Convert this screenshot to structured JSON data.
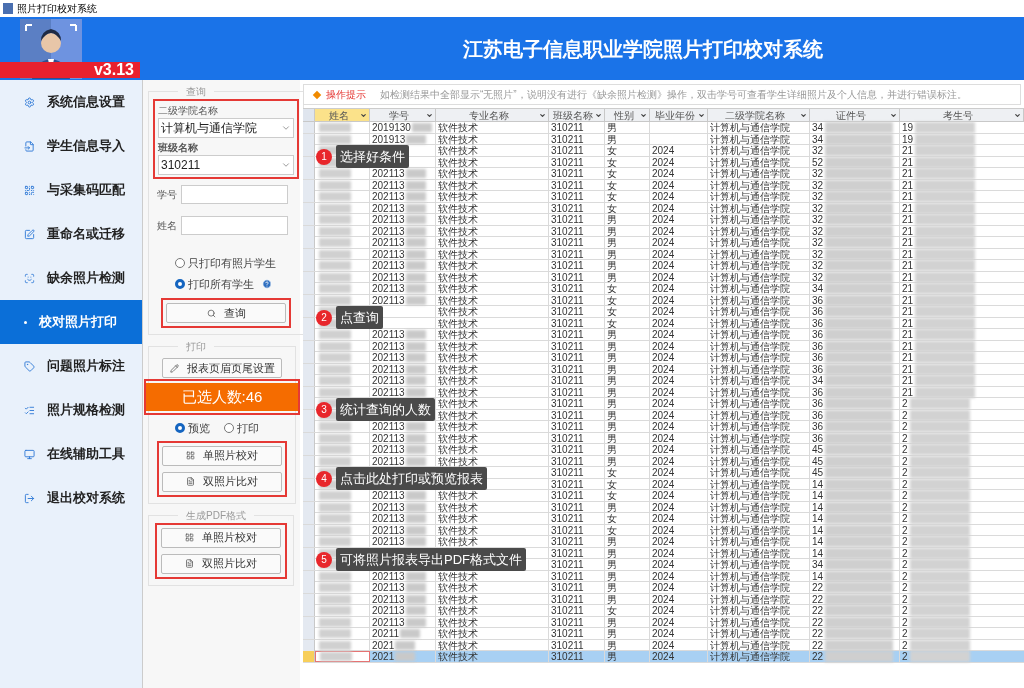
{
  "window": {
    "title": "照片打印校对系统"
  },
  "header": {
    "version": "v3.13",
    "title": "江苏电子信息职业学院照片打印校对系统"
  },
  "sidebar": {
    "items": [
      {
        "label": "系统信息设置",
        "selected": false
      },
      {
        "label": "学生信息导入",
        "selected": false
      },
      {
        "label": "与采集码匹配",
        "selected": false
      },
      {
        "label": "重命名或迁移",
        "selected": false
      },
      {
        "label": "缺余照片检测",
        "selected": false
      },
      {
        "label": "校对照片打印",
        "selected": true
      },
      {
        "label": "问题照片标注",
        "selected": false
      },
      {
        "label": "照片规格检测",
        "selected": false
      },
      {
        "label": "在线辅助工具",
        "selected": false
      },
      {
        "label": "退出校对系统",
        "selected": false
      }
    ]
  },
  "query_panel": {
    "title": "查询",
    "college_label": "二级学院名称",
    "college_value": "计算机与通信学院",
    "class_label": "班级名称",
    "class_value": "310211",
    "student_id_label": "学号",
    "name_label": "姓名",
    "options": [
      {
        "label": "只打印有照片学生",
        "selected": false
      },
      {
        "label": "打印所有学生",
        "selected": true
      }
    ],
    "button": "查询"
  },
  "print_panel": {
    "title": "打印",
    "setup_button": "报表页眉页尾设置",
    "count": "已选人数:46",
    "modes": [
      {
        "label": "预览",
        "selected": true
      },
      {
        "label": "打印",
        "selected": false
      }
    ],
    "buttons": [
      "单照片校对",
      "双照片比对"
    ]
  },
  "pdf_panel": {
    "title": "生成PDF格式",
    "buttons": [
      "单照片校对",
      "双照片比对"
    ]
  },
  "tip": {
    "label": "操作提示",
    "text": "如检测结果中全部显示“无照片”，说明没有进行《缺余照片检测》操作，双击学号可查看学生详细照片及个人信息，并进行错误标注。"
  },
  "table": {
    "columns": [
      {
        "label": "姓名",
        "selected": true
      },
      {
        "label": "学号",
        "selected": false
      },
      {
        "label": "专业名称",
        "selected": false
      },
      {
        "label": "班级名称",
        "selected": false
      },
      {
        "label": "性别",
        "selected": false
      },
      {
        "label": "毕业年份",
        "selected": false
      },
      {
        "label": "二级学院名称",
        "selected": false
      },
      {
        "label": "证件号",
        "selected": false
      },
      {
        "label": "考生号",
        "selected": false
      }
    ],
    "rows": [
      {
        "student_id": "2019130",
        "major": "软件技术",
        "class": "310211",
        "gender": "男",
        "college": "计算机与通信学院",
        "id_number": "34",
        "exam_number": "19",
        "selected": false
      },
      {
        "student_id": "201913",
        "major": "软件技术",
        "class": "310211",
        "gender": "男",
        "college": "计算机与通信学院",
        "id_number": "34",
        "exam_number": "19",
        "selected": false
      },
      {
        "major": "软件技术",
        "class": "310211",
        "gender": "女",
        "year": "2024",
        "college": "计算机与通信学院",
        "id_number": "32",
        "exam_number": "21",
        "selected": false
      },
      {
        "major": "软件技术",
        "class": "310211",
        "gender": "女",
        "year": "2024",
        "college": "计算机与通信学院",
        "id_number": "52",
        "exam_number": "21",
        "selected": false
      },
      {
        "student_id": "202113",
        "major": "软件技术",
        "class": "310211",
        "gender": "女",
        "year": "2024",
        "college": "计算机与通信学院",
        "id_number": "32",
        "exam_number": "21",
        "selected": false
      },
      {
        "student_id": "202113",
        "major": "软件技术",
        "class": "310211",
        "gender": "女",
        "year": "2024",
        "college": "计算机与通信学院",
        "id_number": "32",
        "exam_number": "21",
        "selected": false
      },
      {
        "student_id": "202113",
        "major": "软件技术",
        "class": "310211",
        "gender": "女",
        "year": "2024",
        "college": "计算机与通信学院",
        "id_number": "32",
        "exam_number": "21",
        "selected": false
      },
      {
        "student_id": "202113",
        "major": "软件技术",
        "class": "310211",
        "gender": "女",
        "year": "2024",
        "college": "计算机与通信学院",
        "id_number": "32",
        "exam_number": "21",
        "selected": false
      },
      {
        "student_id": "202113",
        "major": "软件技术",
        "class": "310211",
        "gender": "男",
        "year": "2024",
        "college": "计算机与通信学院",
        "id_number": "32",
        "exam_number": "21",
        "selected": false
      },
      {
        "student_id": "202113",
        "major": "软件技术",
        "class": "310211",
        "gender": "男",
        "year": "2024",
        "college": "计算机与通信学院",
        "id_number": "32",
        "exam_number": "21",
        "selected": false
      },
      {
        "student_id": "202113",
        "major": "软件技术",
        "class": "310211",
        "gender": "男",
        "year": "2024",
        "college": "计算机与通信学院",
        "id_number": "32",
        "exam_number": "21",
        "selected": false
      },
      {
        "student_id": "202113",
        "major": "软件技术",
        "class": "310211",
        "gender": "男",
        "year": "2024",
        "college": "计算机与通信学院",
        "id_number": "32",
        "exam_number": "21",
        "selected": false
      },
      {
        "student_id": "202113",
        "major": "软件技术",
        "class": "310211",
        "gender": "男",
        "year": "2024",
        "college": "计算机与通信学院",
        "id_number": "32",
        "exam_number": "21",
        "selected": false
      },
      {
        "student_id": "202113",
        "major": "软件技术",
        "class": "310211",
        "gender": "男",
        "year": "2024",
        "college": "计算机与通信学院",
        "id_number": "32",
        "exam_number": "21",
        "selected": false
      },
      {
        "student_id": "202113",
        "major": "软件技术",
        "class": "310211",
        "gender": "女",
        "year": "2024",
        "college": "计算机与通信学院",
        "id_number": "34",
        "exam_number": "21",
        "selected": false
      },
      {
        "student_id": "202113",
        "major": "软件技术",
        "class": "310211",
        "gender": "女",
        "year": "2024",
        "college": "计算机与通信学院",
        "id_number": "36",
        "exam_number": "21",
        "selected": false
      },
      {
        "major": "软件技术",
        "class": "310211",
        "gender": "女",
        "year": "2024",
        "college": "计算机与通信学院",
        "id_number": "36",
        "exam_number": "21",
        "selected": false
      },
      {
        "major": "软件技术",
        "class": "310211",
        "gender": "女",
        "year": "2024",
        "college": "计算机与通信学院",
        "id_number": "36",
        "exam_number": "21",
        "selected": false
      },
      {
        "student_id": "202113",
        "major": "软件技术",
        "class": "310211",
        "gender": "男",
        "year": "2024",
        "college": "计算机与通信学院",
        "id_number": "36",
        "exam_number": "21",
        "selected": false
      },
      {
        "student_id": "202113",
        "major": "软件技术",
        "class": "310211",
        "gender": "男",
        "year": "2024",
        "college": "计算机与通信学院",
        "id_number": "36",
        "exam_number": "21",
        "selected": false
      },
      {
        "student_id": "202113",
        "major": "软件技术",
        "class": "310211",
        "gender": "男",
        "year": "2024",
        "college": "计算机与通信学院",
        "id_number": "36",
        "exam_number": "21",
        "selected": false
      },
      {
        "student_id": "202113",
        "major": "软件技术",
        "class": "310211",
        "gender": "男",
        "year": "2024",
        "college": "计算机与通信学院",
        "id_number": "36",
        "exam_number": "21",
        "selected": false
      },
      {
        "student_id": "202113",
        "major": "软件技术",
        "class": "310211",
        "gender": "男",
        "year": "2024",
        "college": "计算机与通信学院",
        "id_number": "34",
        "exam_number": "21",
        "selected": false
      },
      {
        "student_id": "202113",
        "major": "软件技术",
        "class": "310211",
        "gender": "男",
        "year": "2024",
        "college": "计算机与通信学院",
        "id_number": "36",
        "exam_number": "21",
        "selected": false
      },
      {
        "major": "软件技术",
        "class": "310211",
        "gender": "男",
        "year": "2024",
        "college": "计算机与通信学院",
        "id_number": "36",
        "exam_number": "2",
        "selected": false
      },
      {
        "major": "软件技术",
        "class": "310211",
        "gender": "男",
        "year": "2024",
        "college": "计算机与通信学院",
        "id_number": "36",
        "exam_number": "2",
        "selected": false
      },
      {
        "student_id": "202113",
        "major": "软件技术",
        "class": "310211",
        "gender": "男",
        "year": "2024",
        "college": "计算机与通信学院",
        "id_number": "36",
        "exam_number": "2",
        "selected": false
      },
      {
        "student_id": "202113",
        "major": "软件技术",
        "class": "310211",
        "gender": "男",
        "year": "2024",
        "college": "计算机与通信学院",
        "id_number": "36",
        "exam_number": "2",
        "selected": false
      },
      {
        "student_id": "202113",
        "major": "软件技术",
        "class": "310211",
        "gender": "男",
        "year": "2024",
        "college": "计算机与通信学院",
        "id_number": "45",
        "exam_number": "2",
        "selected": false
      },
      {
        "student_id": "202113",
        "major": "软件技术",
        "class": "310211",
        "gender": "男",
        "year": "2024",
        "college": "计算机与通信学院",
        "id_number": "45",
        "exam_number": "2",
        "selected": false
      },
      {
        "class": "310211",
        "gender": "女",
        "year": "2024",
        "college": "计算机与通信学院",
        "id_number": "45",
        "exam_number": "2",
        "selected": false
      },
      {
        "class": "310211",
        "gender": "女",
        "year": "2024",
        "college": "计算机与通信学院",
        "id_number": "14",
        "exam_number": "2",
        "selected": false
      },
      {
        "student_id": "202113",
        "major": "软件技术",
        "class": "310211",
        "gender": "女",
        "year": "2024",
        "college": "计算机与通信学院",
        "id_number": "14",
        "exam_number": "2",
        "selected": false
      },
      {
        "student_id": "202113",
        "major": "软件技术",
        "class": "310211",
        "gender": "男",
        "year": "2024",
        "college": "计算机与通信学院",
        "id_number": "14",
        "exam_number": "2",
        "selected": false
      },
      {
        "student_id": "202113",
        "major": "软件技术",
        "class": "310211",
        "gender": "女",
        "year": "2024",
        "college": "计算机与通信学院",
        "id_number": "14",
        "exam_number": "2",
        "selected": false
      },
      {
        "student_id": "202113",
        "major": "软件技术",
        "class": "310211",
        "gender": "女",
        "year": "2024",
        "college": "计算机与通信学院",
        "id_number": "14",
        "exam_number": "2",
        "selected": false
      },
      {
        "student_id": "202113",
        "major": "软件技术",
        "class": "310211",
        "gender": "男",
        "year": "2024",
        "college": "计算机与通信学院",
        "id_number": "14",
        "exam_number": "2",
        "selected": false
      },
      {
        "class": "310211",
        "gender": "男",
        "year": "2024",
        "college": "计算机与通信学院",
        "id_number": "14",
        "exam_number": "2",
        "selected": false
      },
      {
        "class": "310211",
        "gender": "男",
        "year": "2024",
        "college": "计算机与通信学院",
        "id_number": "34",
        "exam_number": "2",
        "selected": false
      },
      {
        "student_id": "202113",
        "major": "软件技术",
        "class": "310211",
        "gender": "男",
        "year": "2024",
        "college": "计算机与通信学院",
        "id_number": "14",
        "exam_number": "2",
        "selected": false
      },
      {
        "student_id": "202113",
        "major": "软件技术",
        "class": "310211",
        "gender": "男",
        "year": "2024",
        "college": "计算机与通信学院",
        "id_number": "22",
        "exam_number": "2",
        "selected": false
      },
      {
        "student_id": "202113",
        "major": "软件技术",
        "class": "310211",
        "gender": "男",
        "year": "2024",
        "college": "计算机与通信学院",
        "id_number": "22",
        "exam_number": "2",
        "selected": false
      },
      {
        "student_id": "202113",
        "major": "软件技术",
        "class": "310211",
        "gender": "女",
        "year": "2024",
        "college": "计算机与通信学院",
        "id_number": "22",
        "exam_number": "2",
        "selected": false
      },
      {
        "student_id": "202113",
        "major": "软件技术",
        "class": "310211",
        "gender": "男",
        "year": "2024",
        "college": "计算机与通信学院",
        "id_number": "22",
        "exam_number": "2",
        "selected": false
      },
      {
        "student_id": "20211",
        "major": "软件技术",
        "class": "310211",
        "gender": "男",
        "year": "2024",
        "college": "计算机与通信学院",
        "id_number": "22",
        "exam_number": "2",
        "selected": false
      },
      {
        "student_id": "2021",
        "major": "软件技术",
        "class": "310211",
        "gender": "男",
        "year": "2024",
        "college": "计算机与通信学院",
        "id_number": "22",
        "exam_number": "2",
        "selected": false
      },
      {
        "student_id": "2021",
        "major": "软件技术",
        "class": "310211",
        "gender": "男",
        "year": "2024",
        "college": "计算机与通信学院",
        "id_number": "22",
        "exam_number": "2",
        "selected": true
      }
    ]
  },
  "callouts": [
    {
      "number": "1",
      "text": "选择好条件"
    },
    {
      "number": "2",
      "text": "点查询"
    },
    {
      "number": "3",
      "text": "统计查询的人数"
    },
    {
      "number": "4",
      "text": "点击此处打印或预览报表"
    },
    {
      "number": "5",
      "text": "可将照片报表导出PDF格式文件"
    }
  ]
}
